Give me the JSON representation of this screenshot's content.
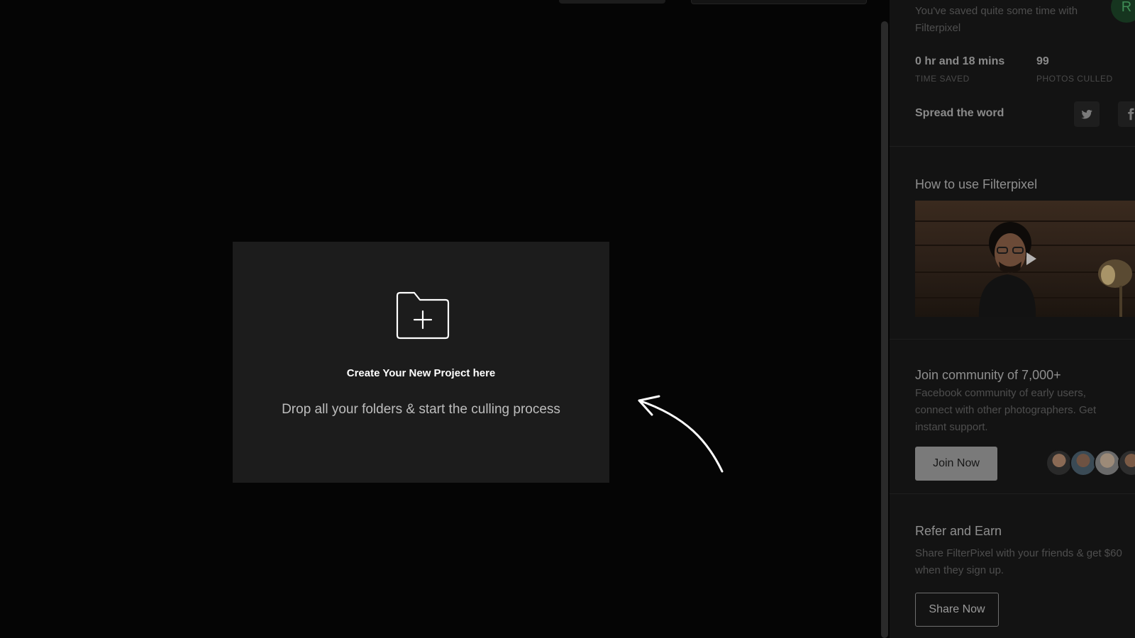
{
  "sidebar": {
    "summary_text": "You've saved quite some time with Filterpixel",
    "avatar_initial": "R",
    "stats": [
      {
        "value": "0 hr and 18 mins",
        "label": "TIME SAVED"
      },
      {
        "value": "99",
        "label": "PHOTOS CULLED"
      }
    ],
    "spread_label": "Spread the word",
    "social_icons": [
      "twitter-icon",
      "facebook-icon"
    ],
    "howto_title": "How to use Filterpixel",
    "community_title": "Join community of 7,000+",
    "community_desc": "Facebook community of early users, connect with other photographers. Get instant support.",
    "join_label": "Join Now",
    "refer_title": "Refer and Earn",
    "refer_desc": "Share FilterPixel with your friends & get $60 when they sign up.",
    "share_label": "Share Now"
  },
  "main": {
    "card_icon": "folder-plus-icon",
    "card_title": "Create Your New Project here",
    "card_subtitle": "Drop all your folders & start the culling process",
    "pointer_icon": "curved-arrow-icon"
  },
  "colors": {
    "background": "#050505",
    "card": "#1c1c1c",
    "sidebar": "#131313",
    "accent": "#3f8c55"
  }
}
